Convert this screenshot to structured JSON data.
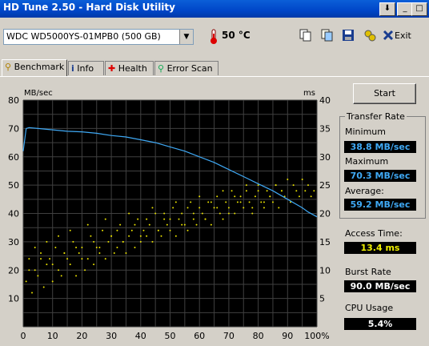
{
  "window": {
    "title": "HD Tune 2.50 - Hard Disk Utility",
    "buttons": [
      "⬇",
      "_",
      "□"
    ]
  },
  "toolbar": {
    "drive": "WDC WD5000YS-01MPB0 (500 GB)",
    "temperature": "50 °C",
    "exit_label": "Exit",
    "icons": [
      "copy-text-icon",
      "copy-screenshot-icon",
      "save-icon",
      "options-icon",
      "exit-icon"
    ]
  },
  "tabs": [
    {
      "label": "Benchmark",
      "active": true
    },
    {
      "label": "Info",
      "active": false
    },
    {
      "label": "Health",
      "active": false
    },
    {
      "label": "Error Scan",
      "active": false
    }
  ],
  "benchmark": {
    "start_label": "Start",
    "transfer_rate": {
      "group_title": "Transfer Rate",
      "minimum_label": "Minimum",
      "minimum": "38.8 MB/sec",
      "maximum_label": "Maximum",
      "maximum": "70.3 MB/sec",
      "average_label": "Average:",
      "average": "59.2 MB/sec"
    },
    "access_time_label": "Access Time:",
    "access_time": "13.4 ms",
    "burst_rate_label": "Burst Rate",
    "burst_rate": "90.0 MB/sec",
    "cpu_usage_label": "CPU Usage",
    "cpu_usage": "5.4%"
  },
  "chart_data": {
    "type": "line",
    "left_axis_label": "MB/sec",
    "right_axis_label": "ms",
    "ylim_left": [
      0,
      80
    ],
    "ylim_right": [
      0,
      40
    ],
    "xlim": [
      0,
      100
    ],
    "x_ticks": [
      "0",
      "10",
      "20",
      "30",
      "40",
      "50",
      "60",
      "70",
      "80",
      "90",
      "100%"
    ],
    "y_ticks_left": [
      "10",
      "20",
      "30",
      "40",
      "50",
      "60",
      "70",
      "80"
    ],
    "y_ticks_right": [
      "5",
      "10",
      "15",
      "20",
      "25",
      "30",
      "35",
      "40"
    ],
    "grid": true,
    "transfer_rate_series": {
      "x": [
        0,
        1,
        2,
        5,
        10,
        15,
        20,
        25,
        30,
        35,
        40,
        45,
        50,
        55,
        60,
        65,
        70,
        75,
        80,
        85,
        90,
        95,
        97,
        100
      ],
      "y": [
        62,
        70,
        70.3,
        70,
        69.5,
        69,
        68.8,
        68.3,
        67.5,
        67,
        66,
        65,
        63.5,
        62,
        60,
        58,
        55.5,
        53,
        50.5,
        48,
        45,
        42,
        40.5,
        38.8
      ]
    },
    "access_time_series": {
      "x": [
        1,
        2,
        3,
        4,
        5,
        6,
        7,
        8,
        9,
        10,
        11,
        12,
        13,
        14,
        15,
        16,
        17,
        18,
        19,
        20,
        21,
        22,
        23,
        24,
        25,
        26,
        27,
        28,
        29,
        30,
        31,
        32,
        33,
        34,
        35,
        36,
        37,
        38,
        39,
        40,
        41,
        42,
        43,
        44,
        45,
        46,
        47,
        48,
        49,
        50,
        51,
        52,
        53,
        54,
        55,
        56,
        57,
        58,
        59,
        60,
        61,
        62,
        63,
        64,
        65,
        66,
        67,
        68,
        69,
        70,
        71,
        72,
        73,
        74,
        75,
        76,
        77,
        78,
        79,
        80,
        81,
        82,
        83,
        84,
        85,
        86,
        87,
        88,
        89,
        90,
        91,
        92,
        93,
        94,
        95,
        96,
        97,
        98,
        99,
        2,
        4,
        6,
        8,
        10,
        12,
        14,
        16,
        18,
        20,
        22,
        24,
        26,
        28,
        30,
        32,
        34,
        36,
        38,
        40,
        42,
        44,
        46,
        48,
        50,
        52,
        54,
        56,
        58,
        60,
        62,
        64,
        66,
        68,
        70,
        72,
        74,
        76,
        78,
        80,
        82,
        84,
        86,
        88
      ],
      "y": [
        8,
        12,
        6,
        10,
        9,
        13,
        7,
        11,
        12,
        8,
        14,
        10,
        9,
        13,
        12,
        11,
        15,
        9,
        13,
        14,
        10,
        12,
        16,
        11,
        14,
        13,
        17,
        12,
        15,
        16,
        13,
        14,
        18,
        15,
        13,
        16,
        17,
        14,
        19,
        15,
        17,
        16,
        18,
        15,
        20,
        17,
        16,
        19,
        18,
        17,
        21,
        16,
        19,
        20,
        18,
        17,
        22,
        19,
        18,
        21,
        20,
        19,
        22,
        18,
        21,
        23,
        20,
        19,
        22,
        21,
        24,
        20,
        22,
        23,
        21,
        24,
        22,
        20,
        23,
        25,
        22,
        21,
        24,
        23,
        22,
        25,
        21,
        24,
        23,
        26,
        22,
        25,
        24,
        23,
        26,
        24,
        25,
        23,
        24,
        10,
        14,
        12,
        15,
        11,
        16,
        13,
        17,
        14,
        12,
        18,
        15,
        14,
        19,
        16,
        17,
        15,
        20,
        18,
        16,
        19,
        21,
        17,
        20,
        19,
        22,
        18,
        21,
        20,
        23,
        19,
        22,
        21,
        24,
        20,
        23,
        22,
        25,
        21,
        24,
        22,
        23,
        25,
        24
      ]
    }
  }
}
